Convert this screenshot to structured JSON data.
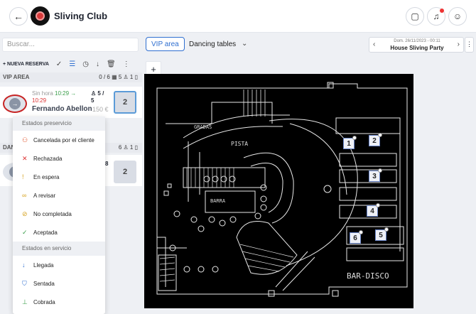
{
  "header": {
    "club_name": "Sliving Club",
    "icons": [
      "back-arrow-icon",
      "chat-icon",
      "bell-icon",
      "user-icon"
    ]
  },
  "search": {
    "placeholder": "Buscar..."
  },
  "toolbar": {
    "new_reservation": "+ NUEVA RESERVA",
    "icons": [
      "check-icon",
      "list-icon",
      "clock-icon",
      "arrow-down-icon",
      "trash-icon",
      "more-vertical-icon"
    ]
  },
  "areas": [
    {
      "name": "VIP AREA",
      "counts": "0 / 6 ▦  5 ♙  1 ▯"
    },
    {
      "name": "DAN",
      "counts": "6 ♙  1 ▯"
    }
  ],
  "reservation": {
    "time_label": "Sin hora",
    "time_green": "10:29 →",
    "time_red": "10:29",
    "pax_line1": "♙ 5 /",
    "pax_line2": "5",
    "name": "Fernando Abellon",
    "price": "150 €",
    "table": "2"
  },
  "reservation2": {
    "pax": "8",
    "table": "2"
  },
  "status_menu": {
    "section1": "Estados preservicio",
    "preservice": [
      {
        "label": "Cancelada por el cliente",
        "icon": "user-x-icon",
        "color": "#e0552d"
      },
      {
        "label": "Rechazada",
        "icon": "x-icon",
        "color": "#d33"
      },
      {
        "label": "En espera",
        "icon": "exclamation-icon",
        "color": "#d6a21e"
      },
      {
        "label": "A revisar",
        "icon": "glasses-icon",
        "color": "#d6a21e"
      },
      {
        "label": "No completada",
        "icon": "no-check-icon",
        "color": "#d6a21e"
      },
      {
        "label": "Aceptada",
        "icon": "check-icon",
        "color": "#3a9e4a"
      }
    ],
    "section2": "Estados en servicio",
    "inservice": [
      {
        "label": "Llegada",
        "icon": "arrow-down-icon",
        "color": "#2f6fd0"
      },
      {
        "label": "Sentada",
        "icon": "seat-icon",
        "color": "#2f6fd0"
      },
      {
        "label": "Cobrada",
        "icon": "cash-icon",
        "color": "#3a9e4a"
      }
    ]
  },
  "tabs": [
    {
      "label": "VIP area",
      "active": true
    },
    {
      "label": "Dancing tables",
      "active": false
    }
  ],
  "date_nav": {
    "date": "Dom. 26/11/2023 - 00:11",
    "event": "House Sliving Party"
  },
  "zoom": {
    "in": "+",
    "out": "−"
  },
  "floor_plan": {
    "labels": {
      "gradas": "GRADAS",
      "pista": "PISTA",
      "barra": "BARRA",
      "bar_disco": "BAR-DISCO"
    },
    "tables": [
      "1",
      "2",
      "3",
      "4",
      "5",
      "6"
    ]
  }
}
